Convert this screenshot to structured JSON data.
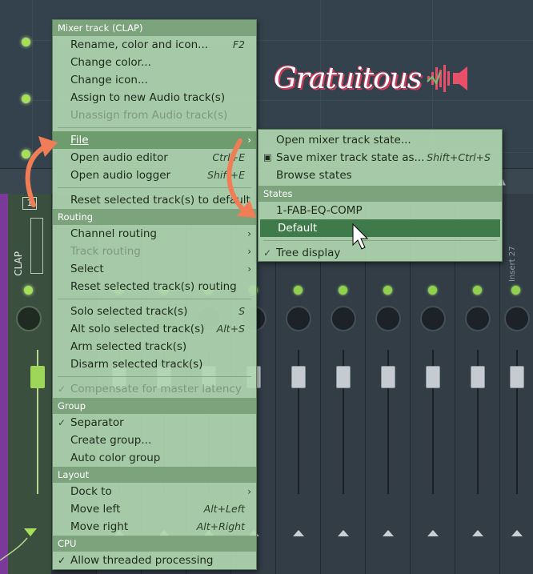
{
  "logo": {
    "text": "Gratuitous"
  },
  "mixer": {
    "clap_number": "1",
    "clap_name": "CLAP",
    "strip_insert_partial": "Insert 27",
    "top_right_number": "27"
  },
  "main_menu": {
    "header_track": "Mixer track (CLAP)",
    "rename": {
      "label": "Rename, color and icon...",
      "shortcut": "F2"
    },
    "change_color": "Change color...",
    "change_icon": "Change icon...",
    "assign_audio": "Assign to new Audio track(s)",
    "unassign_audio": "Unassign from Audio track(s)",
    "file": "File",
    "open_audio_editor": {
      "label": "Open audio editor",
      "shortcut": "Ctrl+E"
    },
    "open_audio_logger": {
      "label": "Open audio logger",
      "shortcut": "Shift+E"
    },
    "reset_to_default": "Reset selected track(s) to default",
    "header_routing": "Routing",
    "channel_routing": "Channel routing",
    "track_routing": "Track routing",
    "select": "Select",
    "reset_routing": "Reset selected track(s) routing",
    "solo": {
      "label": "Solo selected track(s)",
      "shortcut": "S"
    },
    "alt_solo": {
      "label": "Alt solo selected track(s)",
      "shortcut": "Alt+S"
    },
    "arm": "Arm selected track(s)",
    "disarm": "Disarm selected track(s)",
    "compensate": "Compensate for master latency",
    "header_group": "Group",
    "separator": "Separator",
    "create_group": "Create group...",
    "auto_color_group": "Auto color group",
    "header_layout": "Layout",
    "dock_to": "Dock to",
    "move_left": {
      "label": "Move left",
      "shortcut": "Alt+Left"
    },
    "move_right": {
      "label": "Move right",
      "shortcut": "Alt+Right"
    },
    "header_cpu": "CPU",
    "threaded": "Allow threaded processing"
  },
  "sub_menu": {
    "open_state": "Open mixer track state...",
    "save_state": {
      "label": "Save mixer track state as...",
      "shortcut": "Shift+Ctrl+S"
    },
    "browse_states": "Browse states",
    "header_states": "States",
    "state_1": "1-FAB-EQ-COMP",
    "state_default": "Default",
    "tree_display": "Tree display"
  },
  "colors": {
    "menu_bg": "#b0d6b0",
    "menu_header": "#769c76",
    "selected": "#3f7a4a",
    "arrow_orange": "#f07d55",
    "led_green": "#a6e05a"
  }
}
